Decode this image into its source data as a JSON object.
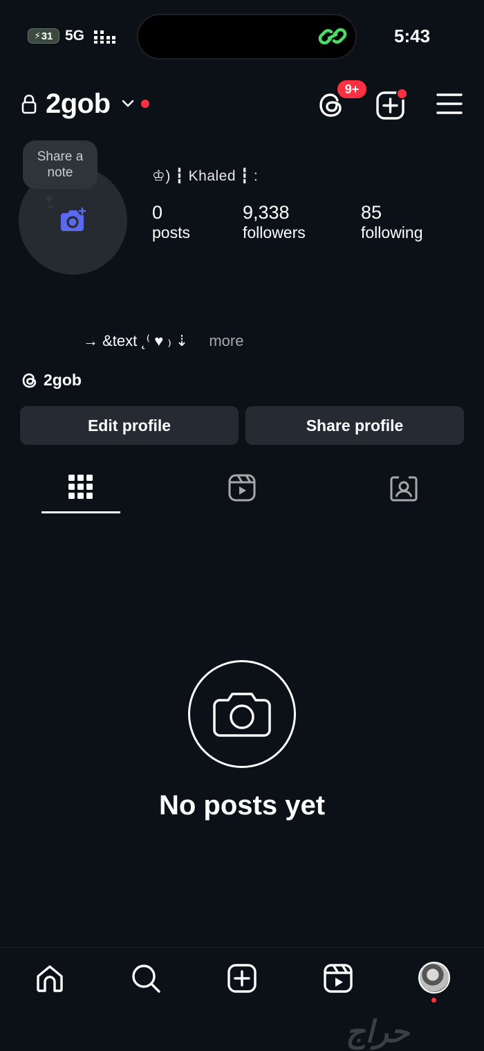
{
  "status_bar": {
    "battery": "31",
    "network": "5G",
    "time": "5:43"
  },
  "header": {
    "username": "2gob",
    "notification_badge": "9+"
  },
  "profile": {
    "note_bubble": "Share a note",
    "name": "♔) ┇ Khaled ┇ :",
    "stats": {
      "posts": {
        "value": "0",
        "label": "posts"
      },
      "followers": {
        "value": "9,338",
        "label": "followers"
      },
      "following": {
        "value": "85",
        "label": "following"
      }
    },
    "bio": "→ &text ˛⁽ ♥ ₎ ⇣",
    "bio_more": "more",
    "threads_handle": "2gob"
  },
  "buttons": {
    "edit_profile": "Edit profile",
    "share_profile": "Share profile"
  },
  "tabs": [
    "grid",
    "reels",
    "tagged"
  ],
  "empty_state": {
    "title": "No posts yet"
  },
  "watermark": "حراج",
  "colors": {
    "background": "#0c1017",
    "button": "#262b33",
    "accent_red": "#ff3040",
    "camera_blue": "#5a6af0",
    "link_green": "#4cd964"
  }
}
